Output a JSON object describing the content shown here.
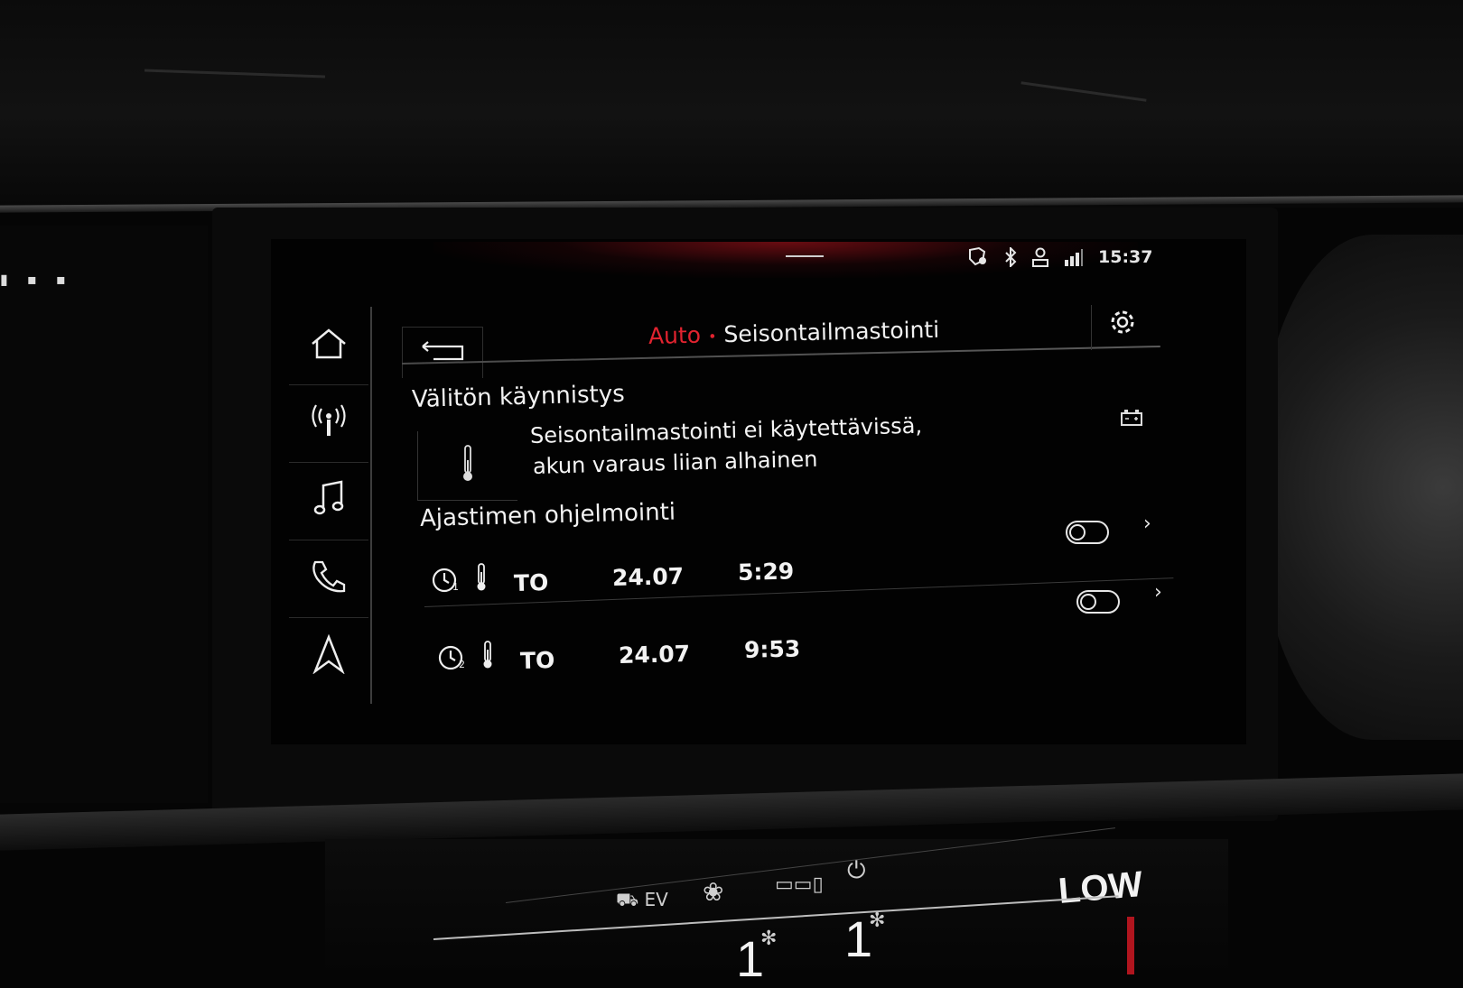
{
  "status_bar": {
    "icons": [
      "location-alert-icon",
      "bluetooth-icon",
      "user-profile-icon",
      "signal-icon"
    ],
    "time": "15:37"
  },
  "nav": {
    "items": [
      {
        "name": "home",
        "icon": "home-icon"
      },
      {
        "name": "radio",
        "icon": "radio-antenna-icon"
      },
      {
        "name": "media",
        "icon": "music-note-icon"
      },
      {
        "name": "phone",
        "icon": "phone-icon"
      },
      {
        "name": "navigation",
        "icon": "navigation-arrow-icon"
      }
    ]
  },
  "header": {
    "breadcrumb_parent": "Auto",
    "breadcrumb_separator": "•",
    "breadcrumb_current": "Seisontailmastointi",
    "back_icon": "back-arrow-icon",
    "settings_icon": "gear-icon"
  },
  "instant_start": {
    "title": "Välitön käynnistys",
    "message_line1": "Seisontailmastointi ei käytettävissä,",
    "message_line2": "akun varaus liian alhainen",
    "icon": "thermometer-icon",
    "status_icon": "battery-icon"
  },
  "timer_programming": {
    "title": "Ajastimen ohjelmointi",
    "timers": [
      {
        "index": "1",
        "day": "TO",
        "date": "24.07",
        "time": "5:29",
        "enabled": false
      },
      {
        "index": "2",
        "day": "TO",
        "date": "24.07",
        "time": "9:53",
        "enabled": false
      }
    ]
  },
  "climate_panel": {
    "ev_label": "EV",
    "mode_label": "LOW",
    "fan_left": "1",
    "fan_right": "1"
  }
}
